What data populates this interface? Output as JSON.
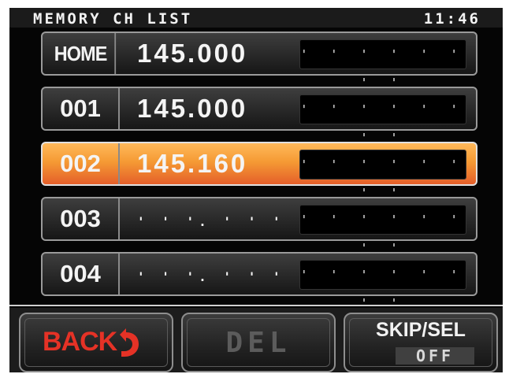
{
  "status": {
    "title": "MEMORY CH LIST",
    "time": "11:46"
  },
  "channels": [
    {
      "label": "HOME",
      "frequency": "145.000",
      "name": "' ' ' ' ' ' ' '"
    },
    {
      "label": "001",
      "frequency": "145.000",
      "name": "' ' ' ' ' ' ' '"
    },
    {
      "label": "002",
      "frequency": "145.160",
      "name": "' ' ' ' ' ' ' '",
      "selected": true
    },
    {
      "label": "003",
      "frequency": "' ' '. ' ' '",
      "name": "' ' ' ' ' ' ' '"
    },
    {
      "label": "004",
      "frequency": "' ' '. ' ' '",
      "name": "' ' ' ' ' ' ' '"
    }
  ],
  "softkeys": {
    "back_label": "BACK",
    "del_label": "DEL",
    "skip_label": "SKIP/SEL",
    "skip_value": "OFF"
  },
  "colors": {
    "selected_row": "#f59a34",
    "back_text": "#e53226",
    "background": "#050505"
  },
  "icons": {
    "back_arrow": "return-arrow-icon"
  }
}
